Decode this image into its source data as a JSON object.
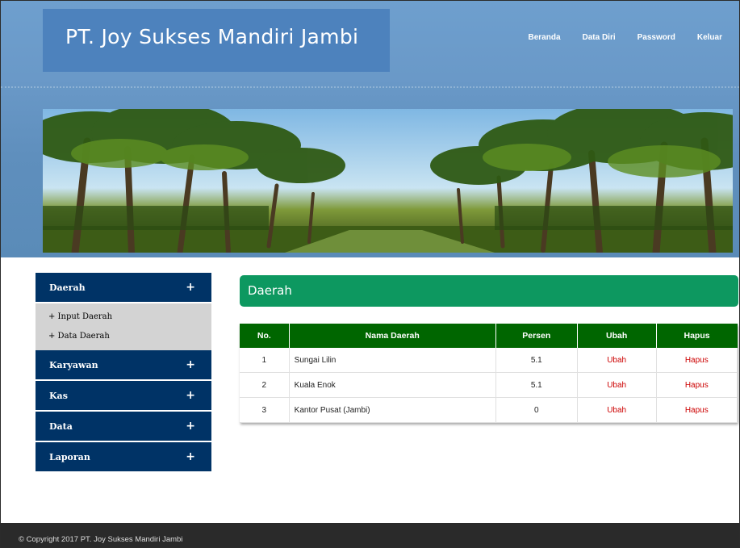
{
  "header": {
    "site_title": "PT. Joy Sukses Mandiri Jambi",
    "nav": [
      "Beranda",
      "Data Diri",
      "Password",
      "Keluar"
    ]
  },
  "sidebar": {
    "menus": [
      {
        "label": "Daerah",
        "toggle": "+",
        "items": [
          "+ Input Daerah",
          "+ Data Daerah"
        ]
      },
      {
        "label": "Karyawan",
        "toggle": "+"
      },
      {
        "label": "Kas",
        "toggle": "+"
      },
      {
        "label": "Data",
        "toggle": "+"
      },
      {
        "label": "Laporan",
        "toggle": "+"
      }
    ]
  },
  "content": {
    "title": "Daerah",
    "table": {
      "headers": [
        "No.",
        "Nama Daerah",
        "Persen",
        "Ubah",
        "Hapus"
      ],
      "rows": [
        [
          "1",
          "Sungai Lilin",
          "5.1",
          "Ubah",
          "Hapus"
        ],
        [
          "2",
          "Kuala Enok",
          "5.1",
          "Ubah",
          "Hapus"
        ],
        [
          "3",
          "Kantor Pusat (Jambi)",
          "0",
          "Ubah",
          "Hapus"
        ]
      ]
    }
  },
  "footer": {
    "copyright": "© Copyright 2017 PT. Joy Sukses Mandiri Jambi"
  },
  "colors": {
    "header_blue": "#5f8fbd",
    "title_box": "#4d82bd",
    "sidebar_navy": "#003366",
    "content_green": "#0d9860",
    "table_head": "#006600",
    "link_red": "#cc0000",
    "footer": "#2a2a2a"
  }
}
